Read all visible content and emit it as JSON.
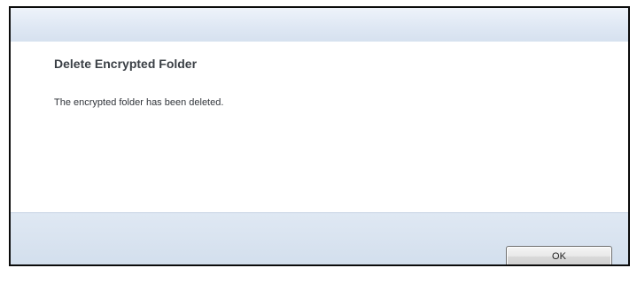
{
  "dialog": {
    "heading": "Delete Encrypted Folder",
    "message": "The encrypted folder has been deleted.",
    "ok_label": "OK"
  },
  "colors": {
    "border": "#0b0b0b",
    "title_bar": "#dfe8f4",
    "button_bar": "#d8e3f0",
    "heading_text": "#3a3f45"
  }
}
